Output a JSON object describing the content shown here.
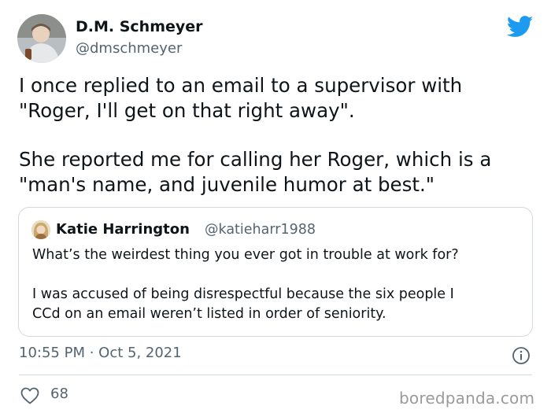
{
  "author": {
    "name": "D.M. Schmeyer",
    "handle": "@dmschmeyer"
  },
  "tweet": {
    "lines_p1": [
      "I once replied to an email to a supervisor with",
      "\"Roger, I'll get on that right away\"."
    ],
    "lines_p2": [
      "She reported me for calling her Roger, which is a",
      "\"man's name, and juvenile humor at best.\""
    ]
  },
  "quoted": {
    "name": "Katie Harrington",
    "handle": "@katieharr1988",
    "line1": "What’s the weirdest thing you ever got in trouble at work for?",
    "line2": "I was accused of being disrespectful because the six people I",
    "line3": "CCd on an email weren’t listed in order of seniority."
  },
  "meta": {
    "timestamp": "10:55 PM · Oct 5, 2021",
    "likes": "68"
  },
  "watermark": "boredpanda.com",
  "icons": {
    "platform": "twitter-bird-icon",
    "info": "info-icon",
    "like": "heart-icon"
  },
  "colors": {
    "accent": "#1d9bf0",
    "text": "#0f1419",
    "secondary": "#536471",
    "border": "#cfd9de",
    "watermark": "#9a9a9a"
  }
}
